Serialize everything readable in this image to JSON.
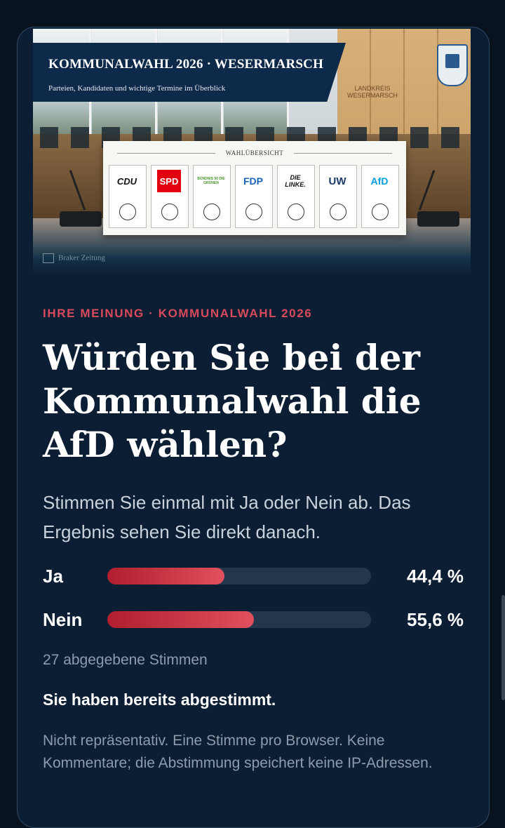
{
  "hero": {
    "title": "KOMMUNALWAHL 2026 · WESERMARSCH",
    "subtitle": "Parteien, Kandidaten und wichtige Termine im Überblick",
    "wall_sign": "LANDKREIS WESERMARSCH",
    "ballot_heading": "WAHLÜBERSICHT",
    "parties": [
      {
        "name": "CDU",
        "color": "#111111"
      },
      {
        "name": "SPD",
        "color": "#e3000f"
      },
      {
        "name": "BÜNDNIS 90 DIE GRÜNEN",
        "color": "#46962b"
      },
      {
        "name": "FDP",
        "color": "#1a64b5"
      },
      {
        "name": "DIE LINKE.",
        "color": "#111111"
      },
      {
        "name": "UW",
        "color": "#1a3a6b"
      },
      {
        "name": "AfD",
        "color": "#009ee0"
      }
    ],
    "publisher": "Braker Zeitung"
  },
  "poll": {
    "kicker": "IHRE MEINUNG · KOMMUNALWAHL 2026",
    "question": "Würden Sie bei der Kommunalwahl die AfD wählen?",
    "intro": "Stimmen Sie einmal mit Ja oder Nein ab. Das Ergebnis sehen Sie direkt danach.",
    "options": [
      {
        "label": "Ja",
        "percent_text": "44,4 %",
        "share": 0.444
      },
      {
        "label": "Nein",
        "percent_text": "55,6 %",
        "share": 0.556
      }
    ],
    "votes_text": "27 abgegebene Stimmen",
    "status_text": "Sie haben bereits abgestimmt.",
    "disclaimer": "Nicht repräsentativ. Eine Stimme pro Browser. Keine Kommentare; die Abstimmung speichert keine IP-Adressen."
  },
  "colors": {
    "accent": "#d84a5c",
    "bar": "#c8323f",
    "background": "#0c1e33"
  }
}
